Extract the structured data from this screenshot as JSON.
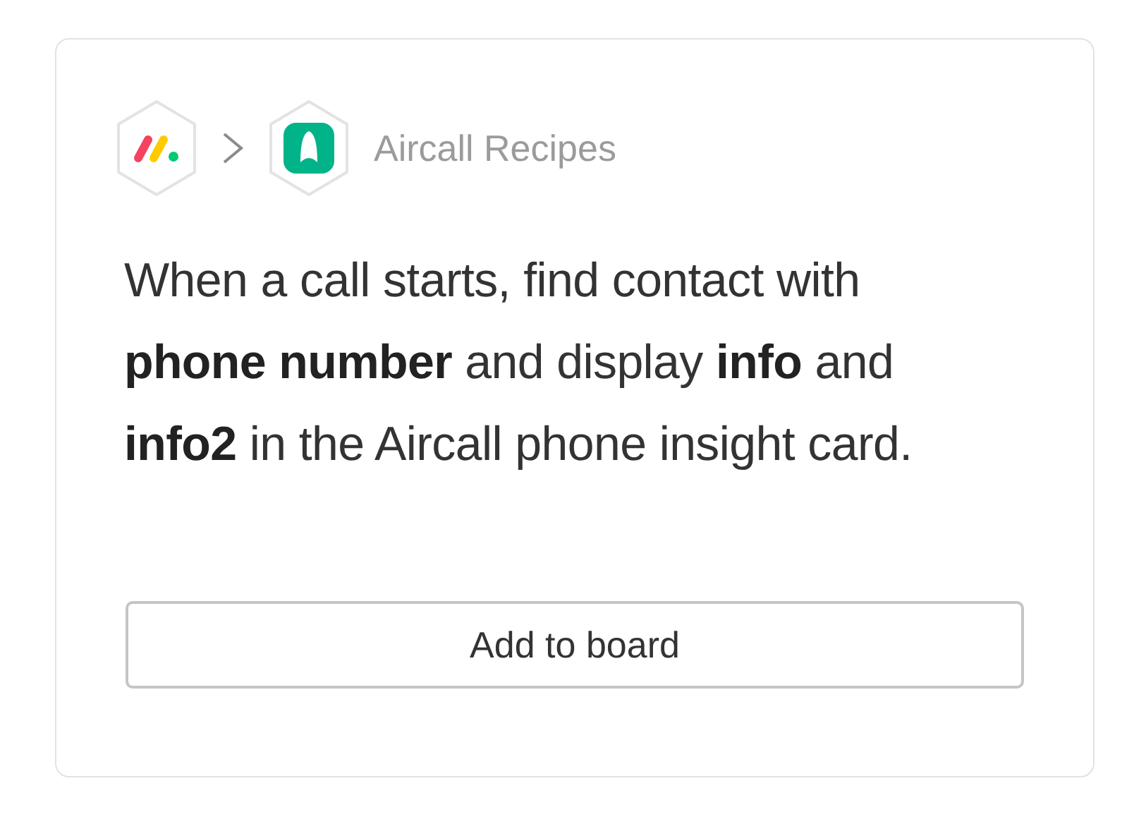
{
  "breadcrumb": {
    "title": "Aircall Recipes"
  },
  "description": "When a call starts, find contact with **phone number** and display **info** and **info2** in the Aircall phone insight card.",
  "button": {
    "label": "Add to board"
  }
}
